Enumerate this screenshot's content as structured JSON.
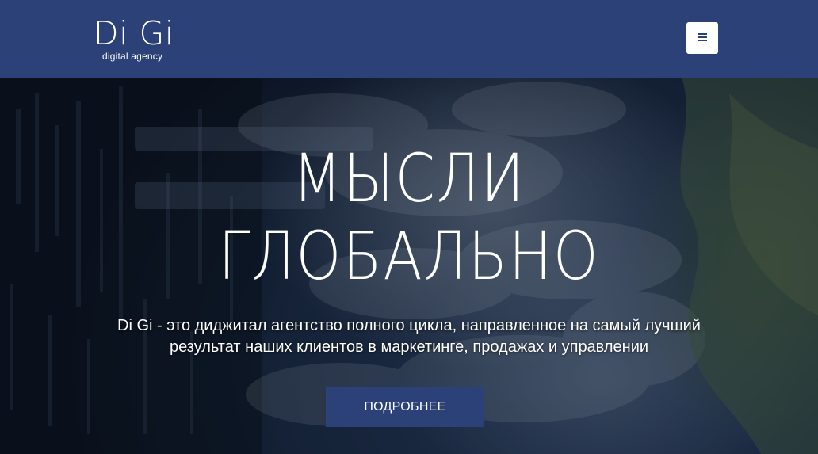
{
  "header": {
    "logo_name": "Di Gi",
    "logo_tagline": "digital agency",
    "menu_icon": "hamburger-menu-icon"
  },
  "hero": {
    "title_line1": "МЫСЛИ",
    "title_line2": "ГЛОБАЛЬНО",
    "subtitle_line1": "Di Gi - это диджитал агентство полного цикла, направленное на самый лучший",
    "subtitle_line2": "результат наших клиентов в маркетинге, продажах и управлении",
    "cta_label": "ПОДРОБНЕЕ"
  },
  "colors": {
    "brand": "#2b4178",
    "text": "#ffffff",
    "menu_button_bg": "#ffffff"
  }
}
